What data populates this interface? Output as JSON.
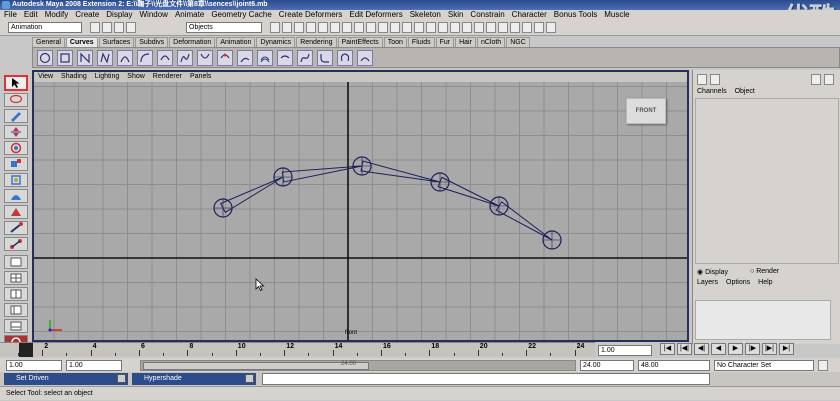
{
  "title_bar": {
    "text": "Autodesk Maya 2008 Extension 2: E:\\\\鞠子\\\\光盘文件\\\\第8章\\\\sences\\\\joint6.mb",
    "watermark": "优酷"
  },
  "menu": [
    "File",
    "Edit",
    "Modify",
    "Create",
    "Display",
    "Window",
    "Animate",
    "Geometry Cache",
    "Create Deformers",
    "Edit Deformers",
    "Skeleton",
    "Skin",
    "Constrain",
    "Character",
    "Bonus Tools",
    "Muscle"
  ],
  "toolbar": {
    "mode_select": "Animation",
    "selection_mask": "Objects"
  },
  "shelf_tabs": [
    "General",
    "Curves",
    "Surfaces",
    "Subdivs",
    "Deformation",
    "Animation",
    "Dynamics",
    "Rendering",
    "PaintEffects",
    "Toon",
    "Fluids",
    "Fur",
    "Hair",
    "nCloth",
    "NGC"
  ],
  "shelf_active": "Curves",
  "viewport": {
    "menu": [
      "View",
      "Shading",
      "Lighting",
      "Show",
      "Renderer",
      "Panels"
    ],
    "view_cube": "FRONT",
    "camera_label": "front"
  },
  "channel_box": {
    "header": [
      "Channels",
      "Object"
    ],
    "display_options": {
      "display": "Display",
      "render": "Render",
      "selected": "Display"
    },
    "layer_menu": [
      "Layers",
      "Options",
      "Help"
    ]
  },
  "timeline": {
    "ticks": [
      "2",
      "4",
      "6",
      "8",
      "10",
      "12",
      "14",
      "16",
      "18",
      "20",
      "22",
      "24"
    ],
    "current_frame_field": "1.00"
  },
  "range_slider": {
    "start_time": "1.00",
    "playback_start": "1.00",
    "playback_end": "24.00",
    "end_time": "48.00",
    "range_label": "24.00"
  },
  "character_set": "No Character Set",
  "playback": [
    "|◀",
    "|◀|",
    "◀|",
    "◀",
    "▶",
    "|▶",
    "|▶|",
    "▶|"
  ],
  "windows": [
    {
      "label": "Set Driven"
    },
    {
      "label": "Hypershade"
    }
  ],
  "help_line": "Select Tool: select an object",
  "colors": {
    "viewport_bg": "#a9a9a9",
    "title_blue": "#2d4c8c",
    "joint_color": "#1e1e5a"
  }
}
